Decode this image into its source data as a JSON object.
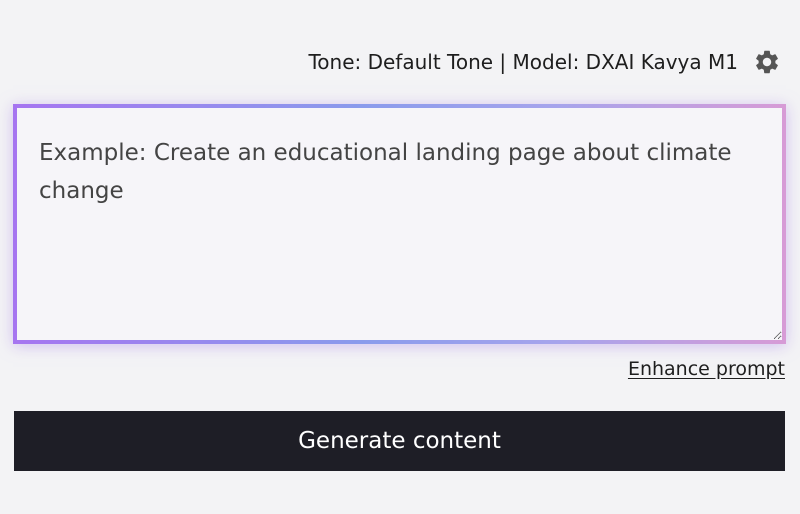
{
  "toolbar": {
    "settings_text": "Tone: Default Tone | Model: DXAI Kavya M1",
    "settings_icon": "gear-icon"
  },
  "prompt": {
    "value": "",
    "placeholder": "Example: Create an educational landing page about climate change"
  },
  "actions": {
    "enhance_label": "Enhance prompt",
    "generate_label": "Generate content"
  },
  "colors": {
    "background": "#f3f3f5",
    "button_bg": "#1e1e26",
    "gradient_start": "#a675f0",
    "gradient_mid": "#8a9bec",
    "gradient_end": "#d79bd6"
  }
}
